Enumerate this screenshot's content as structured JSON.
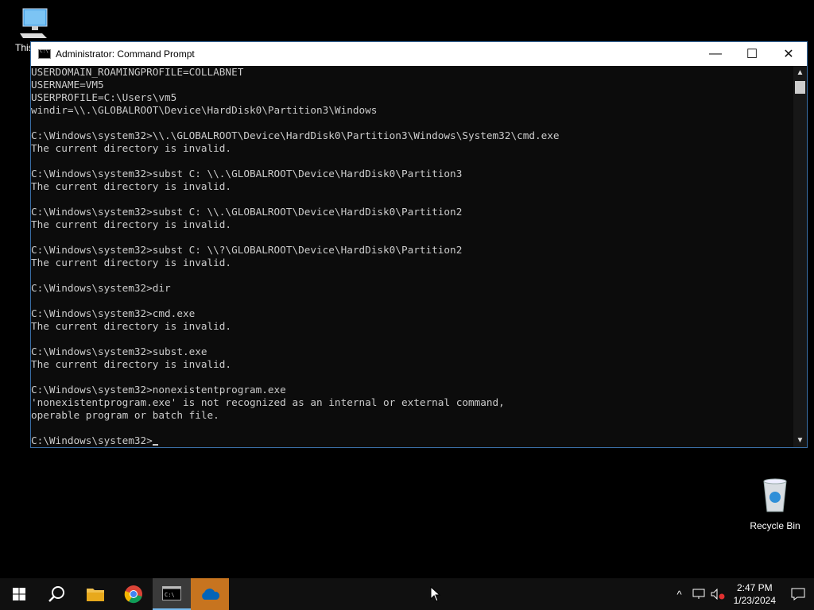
{
  "desktop": {
    "this_pc_label": "This",
    "recycle_bin_label": "Recycle Bin"
  },
  "window": {
    "title": "Administrator: Command Prompt",
    "minimize": "—",
    "maximize": "☐",
    "close": "✕"
  },
  "console": {
    "lines": [
      "USERDOMAIN_ROAMINGPROFILE=COLLABNET",
      "USERNAME=VM5",
      "USERPROFILE=C:\\Users\\vm5",
      "windir=\\\\.\\GLOBALROOT\\Device\\HardDisk0\\Partition3\\Windows",
      "",
      "C:\\Windows\\system32>\\\\.\\GLOBALROOT\\Device\\HardDisk0\\Partition3\\Windows\\System32\\cmd.exe",
      "The current directory is invalid.",
      "",
      "C:\\Windows\\system32>subst C: \\\\.\\GLOBALROOT\\Device\\HardDisk0\\Partition3",
      "The current directory is invalid.",
      "",
      "C:\\Windows\\system32>subst C: \\\\.\\GLOBALROOT\\Device\\HardDisk0\\Partition2",
      "The current directory is invalid.",
      "",
      "C:\\Windows\\system32>subst C: \\\\?\\GLOBALROOT\\Device\\HardDisk0\\Partition2",
      "The current directory is invalid.",
      "",
      "C:\\Windows\\system32>dir",
      "",
      "C:\\Windows\\system32>cmd.exe",
      "The current directory is invalid.",
      "",
      "C:\\Windows\\system32>subst.exe",
      "The current directory is invalid.",
      "",
      "C:\\Windows\\system32>nonexistentprogram.exe",
      "'nonexistentprogram.exe' is not recognized as an internal or external command,",
      "operable program or batch file.",
      ""
    ],
    "prompt": "C:\\Windows\\system32>"
  },
  "taskbar": {
    "apps": [
      "start-icon",
      "search-icon",
      "file-explorer-icon",
      "chrome-icon",
      "command-prompt-icon",
      "onedrive-icon"
    ],
    "clock_time": "2:47 PM",
    "clock_date": "1/23/2024"
  },
  "colors": {
    "console_bg": "#0c0c0c",
    "console_fg": "#cccccc",
    "taskbar_bg": "#101010",
    "accent": "#76b9ed"
  }
}
